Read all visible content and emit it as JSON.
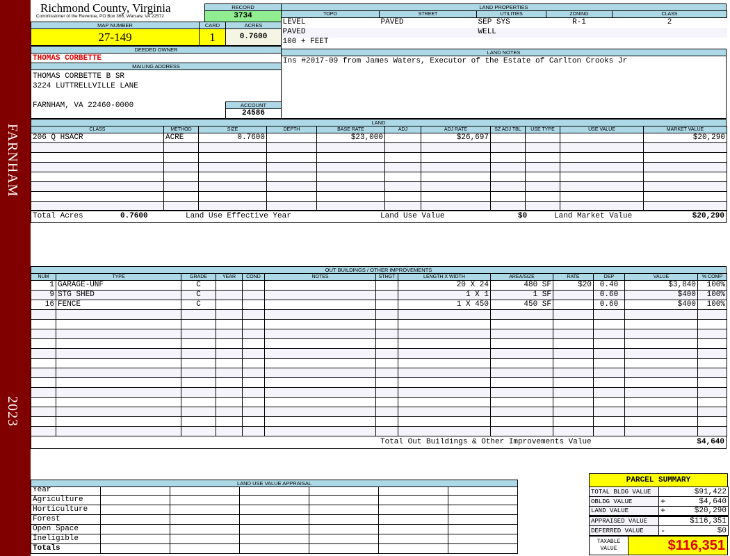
{
  "sidebar": {
    "district": "FARNHAM",
    "year": "2023",
    "color": "#800000"
  },
  "header": {
    "county": "Richmond County, Virginia",
    "office": "Commissioner of the Revenue, PO Box 366, Warsaw, VA 22572",
    "record_label": "RECORD",
    "record": "3734",
    "map_label": "MAP NUMBER",
    "map_number": "27-149",
    "card_label": "CARD",
    "card": "1",
    "acres_label": "ACRES",
    "acres": "0.7600",
    "owner_label": "DEEDED OWNER",
    "owner": "THOMAS CORBETTE",
    "mailing_label": "MAILING ADDRESS",
    "mailing": [
      "THOMAS CORBETTE B SR",
      "3224 LUTTRELLVILLE LANE",
      "",
      "FARNHAM, VA 22460-0000"
    ],
    "account_label": "ACCOUNT",
    "account": "24586"
  },
  "land_properties": {
    "label": "LAND PROPERTIES",
    "columns": [
      "TOPO",
      "STREET",
      "UTILITIES",
      "ZONING",
      "CLASS"
    ],
    "rows": [
      [
        "LEVEL",
        "PAVED",
        "SEP SYS",
        "R-1",
        "2"
      ],
      [
        "PAVED",
        "",
        "WELL",
        "",
        ""
      ],
      [
        "100 + FEET",
        "",
        "",
        "",
        ""
      ]
    ]
  },
  "land_notes": {
    "label": "LAND NOTES",
    "text": "Ins #2017-09 from James Waters, Executor of the Estate of Carlton Crooks Jr"
  },
  "land": {
    "label": "LAND",
    "columns": [
      "CLASS",
      "METHOD",
      "SIZE",
      "DEPTH",
      "BASE RATE",
      "ADJ",
      "ADJ RATE",
      "SZ ADJ TBL",
      "USE TYPE",
      "USE VALUE",
      "MARKET VALUE"
    ],
    "rows": [
      [
        "206 Q HSACR",
        "ACRE",
        "0.7600",
        "",
        "$23,000",
        "",
        "$26,697",
        "",
        "",
        "",
        "$20,290"
      ]
    ],
    "totals": {
      "acres_label": "Total Acres",
      "acres": "0.7600",
      "eff_year_label": "Land Use Effective Year",
      "eff_year": "",
      "use_value_label": "Land Use Value",
      "use_value": "$0",
      "market_label": "Land Market Value",
      "market": "$20,290"
    }
  },
  "outbuildings": {
    "label": "OUT BUILDINGS / OTHER IMPROVEMENTS",
    "columns": [
      "NUM",
      "TYPE",
      "GRADE",
      "YEAR",
      "COND",
      "NOTES",
      "STHGT",
      "LENGTH X WIDTH",
      "AREA/SIZE",
      "RATE",
      "DEP",
      "VALUE",
      "% COMP"
    ],
    "rows": [
      [
        "1",
        "GARAGE-UNF",
        "C",
        "",
        "",
        "",
        "",
        "20 X 24",
        "480 SF",
        "$20",
        "0.40",
        "$3,840",
        "100%"
      ],
      [
        "9",
        "STG SHED",
        "C",
        "",
        "",
        "",
        "",
        "1 X 1",
        "1 SF",
        "",
        "0.60",
        "$400",
        "100%"
      ],
      [
        "16",
        "FENCE",
        "C",
        "",
        "",
        "",
        "",
        "1 X 450",
        "450 SF",
        "",
        "0.60",
        "$400",
        "100%"
      ]
    ],
    "total_label": "Total Out Buildings & Other Improvements Value",
    "total": "$4,640"
  },
  "land_use": {
    "label": "LAND USE VALUE APPRAISAL",
    "rows": [
      "Year",
      "Agriculture",
      "Horticulture",
      "Forest",
      "Open Space",
      "Ineligible",
      "Totals"
    ]
  },
  "parcel_summary": {
    "title": "PARCEL SUMMARY",
    "rows": [
      {
        "label": "TOTAL BLDG VALUE",
        "sign": "",
        "value": "$91,422"
      },
      {
        "label": "OBLDG VALUE",
        "sign": "+",
        "value": "$4,640"
      },
      {
        "label": "LAND VALUE",
        "sign": "+",
        "value": "$20,290"
      },
      {
        "label": "APPRAISED VALUE",
        "sign": "",
        "value": "$116,351"
      },
      {
        "label": "DEFERRED VALUE",
        "sign": "-",
        "value": "$0"
      }
    ],
    "taxable_label": "TAXABLE VALUE",
    "taxable": "$116,351",
    "taxable_color": "#e00000",
    "highlight": "#ffff00"
  }
}
